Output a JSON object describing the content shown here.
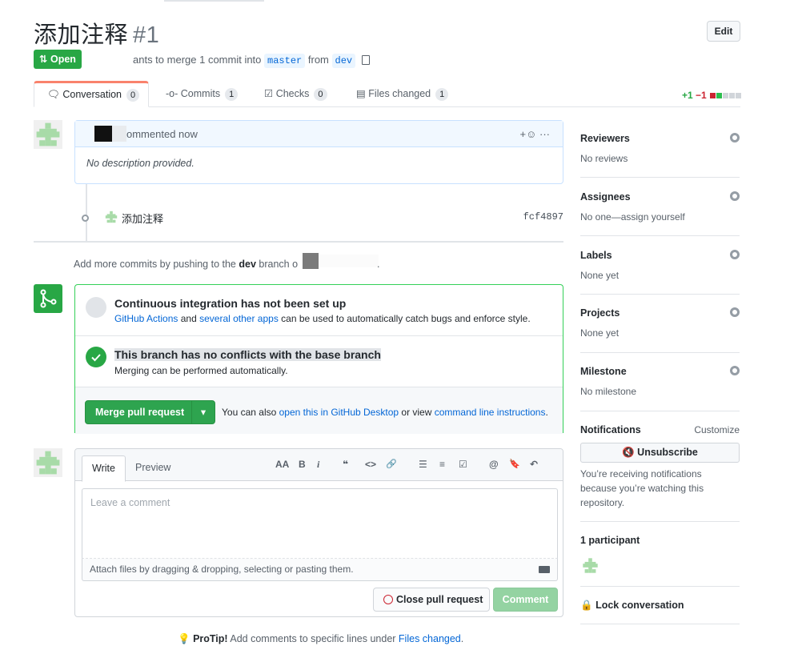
{
  "pr": {
    "title": "添加注释",
    "number": "#1",
    "edit_label": "Edit",
    "state_label": "Open",
    "meta_prefix": "ants to merge 1 commit into",
    "base_branch": "master",
    "meta_from": "from",
    "head_branch": "dev"
  },
  "tabs": [
    {
      "label": "Conversation",
      "count": "0"
    },
    {
      "label": "Commits",
      "count": "1"
    },
    {
      "label": "Checks",
      "count": "0"
    },
    {
      "label": "Files changed",
      "count": "1"
    }
  ],
  "diffstat": {
    "additions": "+1",
    "deletions": "−1"
  },
  "comment": {
    "header_text": "ommented now",
    "body": "No description provided.",
    "actions": "+☺ ···"
  },
  "commit": {
    "message": "添加注释",
    "sha": "fcf4897"
  },
  "push_note": {
    "prefix": "Add more commits by pushing to the",
    "branch": "dev",
    "suffix": "branch o",
    "trailing": "."
  },
  "merge": {
    "ci_title": "Continuous integration has not been set up",
    "ci_link1": "GitHub Actions",
    "ci_and": "and",
    "ci_link2": "several other apps",
    "ci_rest": "can be used to automatically catch bugs and enforce style.",
    "ok_title": "This branch has no conflicts with the base branch",
    "ok_sub": "Merging can be performed automatically.",
    "button": "Merge pull request",
    "tip_prefix": "You can also",
    "tip_link1": "open this in GitHub Desktop",
    "tip_mid": "or view",
    "tip_link2": "command line instructions",
    "tip_end": "."
  },
  "editor": {
    "tab_write": "Write",
    "tab_preview": "Preview",
    "placeholder": "Leave a comment",
    "attach": "Attach files by dragging & dropping, selecting or pasting them.",
    "close_button": "Close pull request",
    "comment_button": "Comment",
    "toolbar": {
      "heading": "AA",
      "bold": "B",
      "italic": "i",
      "quote": "❝",
      "code": "<>",
      "link": "🔗",
      "ul": "☰",
      "ol": "≡",
      "task": "☑",
      "mention": "@",
      "ref": "🔖",
      "reply": "↶"
    }
  },
  "protip": {
    "label": "ProTip!",
    "text": "Add comments to specific lines under",
    "link": "Files changed",
    "end": "."
  },
  "sidebar": {
    "reviewers": {
      "title": "Reviewers",
      "value": "No reviews"
    },
    "assignees": {
      "title": "Assignees",
      "value": "No one—assign yourself"
    },
    "labels": {
      "title": "Labels",
      "value": "None yet"
    },
    "projects": {
      "title": "Projects",
      "value": "None yet"
    },
    "milestone": {
      "title": "Milestone",
      "value": "No milestone"
    },
    "notifications": {
      "title": "Notifications",
      "customize": "Customize",
      "button": "Unsubscribe",
      "note": "You’re receiving notifications because you’re watching this repository."
    },
    "participants": {
      "title": "1 participant"
    },
    "lock": "Lock conversation"
  },
  "colors": {
    "accent_green": "#28a745",
    "link_blue": "#0366d6",
    "tab_orange": "#f9826c",
    "identicon": "#a8dba8"
  }
}
